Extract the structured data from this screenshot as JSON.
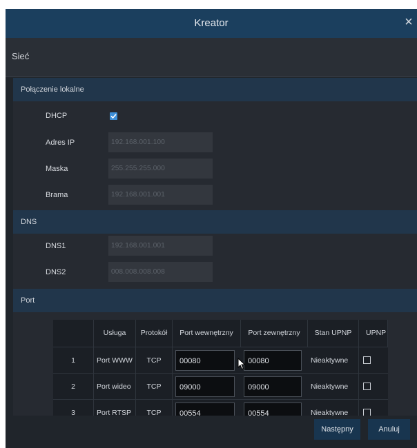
{
  "window": {
    "title": "Kreator",
    "close_glyph": "×"
  },
  "page": {
    "title": "Sieć"
  },
  "local": {
    "section_title": "Połączenie lokalne",
    "dhcp": {
      "label": "DHCP",
      "checked": true
    },
    "ip": {
      "label": "Adres IP",
      "value": "192.168.001.100"
    },
    "mask": {
      "label": "Maska",
      "value": "255.255.255.000"
    },
    "gateway": {
      "label": "Brama",
      "value": "192.168.001.001"
    }
  },
  "dns": {
    "section_title": "DNS",
    "dns1": {
      "label": "DNS1",
      "value": "192.168.001.001"
    },
    "dns2": {
      "label": "DNS2",
      "value": "008.008.008.008"
    }
  },
  "port": {
    "section_title": "Port",
    "columns": [
      "",
      "Usługa",
      "Protokół",
      "Port wewnętrzny",
      "Port zewnętrzny",
      "Stan UPNP",
      "UPNP"
    ],
    "rows": [
      {
        "num": "1",
        "service": "Port WWW",
        "protocol": "TCP",
        "internal": "00080",
        "external": "00080",
        "status": "Nieaktywne"
      },
      {
        "num": "2",
        "service": "Port wideo",
        "protocol": "TCP",
        "internal": "09000",
        "external": "09000",
        "status": "Nieaktywne"
      },
      {
        "num": "3",
        "service": "Port RTSP",
        "protocol": "TCP",
        "internal": "00554",
        "external": "00554",
        "status": "Nieaktywne"
      }
    ]
  },
  "buttons": {
    "next": "Następny",
    "cancel": "Anuluj"
  },
  "colors": {
    "titlebar": "#1b3f5e",
    "section": "#21364b",
    "checkbox": "#3d8fd8",
    "button": "#18354f"
  },
  "icons": {
    "close": "close-icon",
    "dhcp_checkbox": "checkmark-icon",
    "pointer": "mouse-cursor-icon"
  }
}
